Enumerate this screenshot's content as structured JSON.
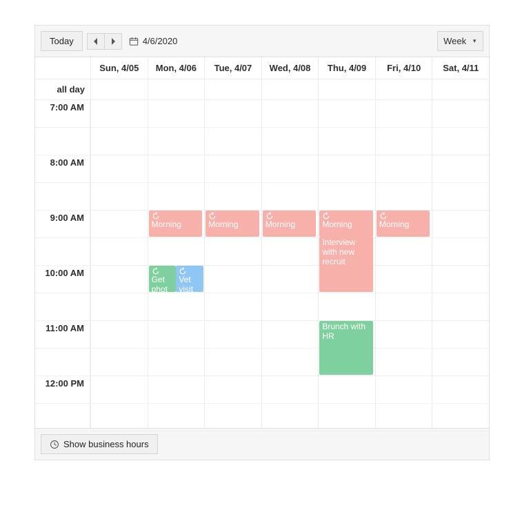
{
  "toolbar": {
    "today_label": "Today",
    "date_display": "4/6/2020",
    "view_label": "Week"
  },
  "columns": {
    "allday_label": "all day",
    "days": [
      {
        "short": "Sun",
        "date": "4/05",
        "label": "Sun, 4/05"
      },
      {
        "short": "Mon",
        "date": "4/06",
        "label": "Mon, 4/06"
      },
      {
        "short": "Tue",
        "date": "4/07",
        "label": "Tue, 4/07"
      },
      {
        "short": "Wed",
        "date": "4/08",
        "label": "Wed, 4/08"
      },
      {
        "short": "Thu",
        "date": "4/09",
        "label": "Thu, 4/09"
      },
      {
        "short": "Fri",
        "date": "4/10",
        "label": "Fri, 4/10"
      },
      {
        "short": "Sat",
        "date": "4/11",
        "label": "Sat, 4/11"
      }
    ]
  },
  "time_slots": [
    "7:00 AM",
    "8:00 AM",
    "9:00 AM",
    "10:00 AM",
    "11:00 AM",
    "12:00 PM"
  ],
  "events": {
    "morning_label": "Morning",
    "get_photo": "Get phot",
    "vet_visit": "Vet visit",
    "interview": "Interview with new recruit",
    "brunch": "Brunch with HR"
  },
  "colors": {
    "pink": "#f8b0ab",
    "green": "#7ed19e",
    "blue": "#8fc6f3"
  },
  "footer": {
    "business_hours": "Show business hours"
  }
}
